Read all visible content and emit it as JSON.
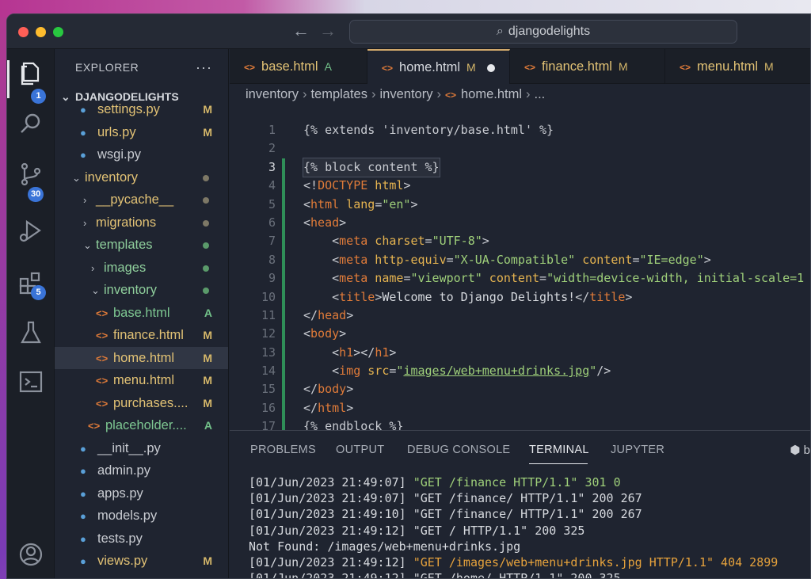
{
  "window": {
    "command_center": "djangodelights"
  },
  "activity_bar": {
    "explorer_badge": "1",
    "source_control_badge": "30",
    "extensions_badge": "5"
  },
  "sidebar": {
    "header": "EXPLORER",
    "more": "···",
    "project": "DJANGODELIGHTS",
    "rows": [
      {
        "name": "settings.py",
        "status": "M"
      },
      {
        "name": "urls.py",
        "status": "M"
      },
      {
        "name": "wsgi.py",
        "status": ""
      },
      {
        "name": "inventory",
        "status": ""
      },
      {
        "name": "__pycache__",
        "status": ""
      },
      {
        "name": "migrations",
        "status": ""
      },
      {
        "name": "templates",
        "status": ""
      },
      {
        "name": "images",
        "status": ""
      },
      {
        "name": "inventory",
        "status": ""
      },
      {
        "name": "base.html",
        "status": "A"
      },
      {
        "name": "finance.html",
        "status": "M"
      },
      {
        "name": "home.html",
        "status": "M"
      },
      {
        "name": "menu.html",
        "status": "M"
      },
      {
        "name": "purchases....",
        "status": "M"
      },
      {
        "name": "placeholder....",
        "status": "A"
      },
      {
        "name": "__init__.py",
        "status": ""
      },
      {
        "name": "admin.py",
        "status": ""
      },
      {
        "name": "apps.py",
        "status": ""
      },
      {
        "name": "models.py",
        "status": ""
      },
      {
        "name": "tests.py",
        "status": ""
      },
      {
        "name": "views.py",
        "status": "M"
      }
    ]
  },
  "tabs": [
    {
      "name": "base.html",
      "status": "A"
    },
    {
      "name": "home.html",
      "status": "M"
    },
    {
      "name": "finance.html",
      "status": "M"
    },
    {
      "name": "menu.html",
      "status": "M"
    }
  ],
  "breadcrumb": [
    "inventory",
    "templates",
    "inventory",
    "home.html",
    "..."
  ],
  "code": {
    "line_numbers": [
      "1",
      "2",
      "3",
      "4",
      "5",
      "6",
      "7",
      "8",
      "9",
      "10",
      "11",
      "12",
      "13",
      "14",
      "15",
      "16",
      "17"
    ],
    "l1": "{% extends 'inventory/base.html' %}",
    "l3": "{% block content %}",
    "l4_a": "<!",
    "l4_b": "DOCTYPE",
    "l4_c": " html",
    "l4_d": ">",
    "l5_open": "<",
    "l5_tag": "html",
    "l5_attr": " lang",
    "l5_eq": "=",
    "l5_str": "\"en\"",
    "l5_close": ">",
    "l6_tag": "head",
    "l7_tag": "meta",
    "l7_attr": " charset",
    "l7_str": "\"UTF-8\"",
    "l8_tag": "meta",
    "l8_attr1": " http-equiv",
    "l8_str1": "\"X-UA-Compatible\"",
    "l8_attr2": " content",
    "l8_str2": "\"IE=edge\"",
    "l9_tag": "meta",
    "l9_attr1": " name",
    "l9_str1": "\"viewport\"",
    "l9_attr2": " content",
    "l9_str2": "\"width=device-width, initial-scale=1",
    "l10_tag": "title",
    "l10_text": "Welcome to Django Delights!",
    "l10_close": "title",
    "l11_close": "head",
    "l12_tag": "body",
    "l13_tag": "h1",
    "l13_close": "h1",
    "l14_tag": "img",
    "l14_attr": " src",
    "l14_str": "images/web+menu+drinks.jpg",
    "l15_close": "body",
    "l16_close": "html",
    "l17": "{% endblock %}"
  },
  "panel": {
    "tabs": [
      "PROBLEMS",
      "OUTPUT",
      "DEBUG CONSOLE",
      "TERMINAL",
      "JUPYTER"
    ],
    "right_label": "b"
  },
  "terminal": [
    {
      "prefix": "[01/Jun/2023 21:49:07] ",
      "body": "\"GET /finance HTTP/1.1\" 301 0",
      "color": "green"
    },
    {
      "prefix": "[01/Jun/2023 21:49:07] ",
      "body": "\"GET /finance/ HTTP/1.1\" 200 267",
      "color": "normal"
    },
    {
      "prefix": "[01/Jun/2023 21:49:10] ",
      "body": "\"GET /finance/ HTTP/1.1\" 200 267",
      "color": "normal"
    },
    {
      "prefix": "[01/Jun/2023 21:49:12] ",
      "body": "\"GET / HTTP/1.1\" 200 325",
      "color": "normal"
    },
    {
      "prefix": "",
      "body": "Not Found: /images/web+menu+drinks.jpg",
      "color": "normal"
    },
    {
      "prefix": "[01/Jun/2023 21:49:12] ",
      "body": "\"GET /images/web+menu+drinks.jpg HTTP/1.1\" 404 2899",
      "color": "orange"
    },
    {
      "prefix": "[01/Jun/2023 21:49:12] ",
      "body": "\"GET /home/ HTTP/1.1\" 200 325",
      "color": "normal"
    }
  ],
  "colors": {
    "accent_badge": "#3a74d8",
    "modified": "#e2c275",
    "added": "#7ec892",
    "gutter_added": "#2f8f58",
    "term_green": "#9fd07a",
    "term_orange": "#e6a23c"
  }
}
